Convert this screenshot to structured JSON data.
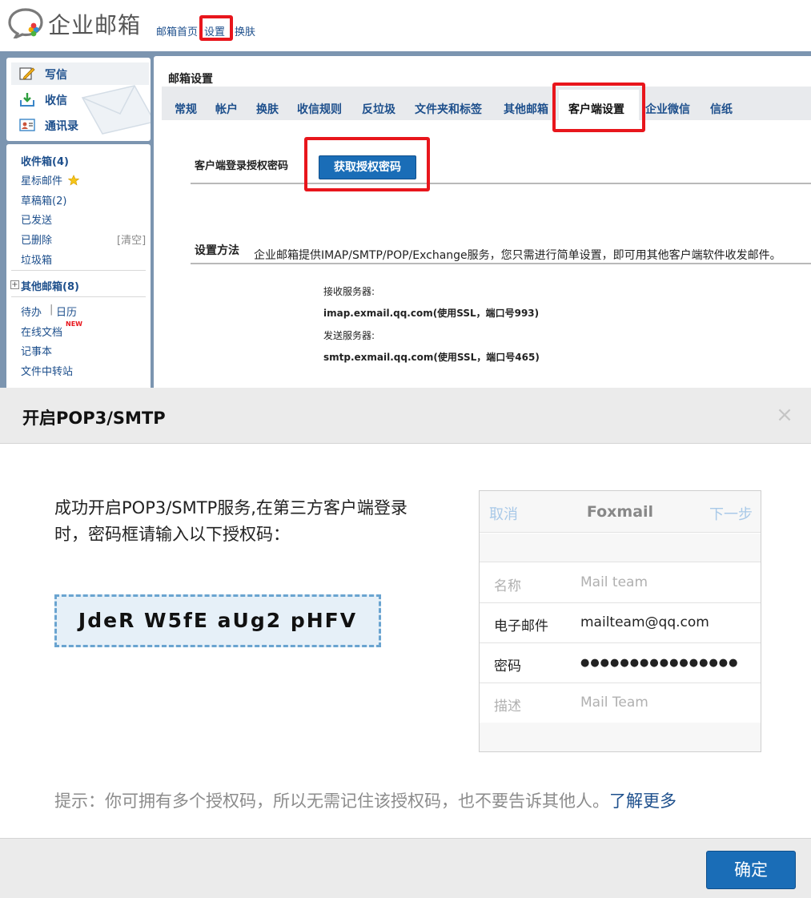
{
  "header": {
    "logo_text": "企业邮箱",
    "links": [
      "邮箱首页",
      "设置",
      "换肤"
    ]
  },
  "sidebar": {
    "compose": [
      {
        "label": "写信",
        "icon": "compose-icon"
      },
      {
        "label": "收信",
        "icon": "inbox-download-icon"
      },
      {
        "label": "通讯录",
        "icon": "contacts-icon"
      }
    ],
    "folders": [
      {
        "label": "收件箱(4)",
        "bold": true
      },
      {
        "label": "星标邮件",
        "icon": "star-icon"
      },
      {
        "label": "草稿箱(2)"
      },
      {
        "label": "已发送"
      },
      {
        "label": "已删除",
        "action": "[清空]"
      },
      {
        "label": "垃圾箱"
      }
    ],
    "other_mailboxes": "其他邮箱(8)",
    "tools": [
      {
        "label": "待办"
      },
      {
        "label": "日历"
      },
      {
        "label": "在线文档",
        "badge": "NEW"
      },
      {
        "label": "记事本"
      },
      {
        "label": "文件中转站"
      }
    ]
  },
  "settings": {
    "title": "邮箱设置",
    "tabs": [
      "常规",
      "帐户",
      "换肤",
      "收信规则",
      "反垃圾",
      "文件夹和标签",
      "其他邮箱",
      "客户端设置",
      "企业微信",
      "信纸"
    ],
    "active_tab": "客户端设置",
    "auth_label": "客户端登录授权密码",
    "auth_button": "获取授权密码",
    "method_label": "设置方法",
    "method_desc": "企业邮箱提供IMAP/SMTP/POP/Exchange服务，您只需进行简单设置，即可用其他客户端软件收发邮件。",
    "recv_label": "接收服务器:",
    "recv_value": "imap.exmail.qq.com(使用SSL，端口号993)",
    "send_label": "发送服务器:",
    "send_value": "smtp.exmail.qq.com(使用SSL，端口号465)"
  },
  "modal": {
    "title": "开启POP3/SMTP",
    "close": "×",
    "message": "成功开启POP3/SMTP服务,在第三方客户端登录时，密码框请输入以下授权码：",
    "code": "JdeR W5fE aUg2 pHFV",
    "tip": "提示：你可拥有多个授权码，所以无需记住该授权码，也不要告诉其他人。",
    "tip_link": "了解更多",
    "ok": "确定"
  },
  "phone": {
    "cancel": "取消",
    "title": "Foxmail",
    "next": "下一步",
    "rows": [
      {
        "k": "名称",
        "v": "Mail team",
        "dim": true
      },
      {
        "k": "电子邮件",
        "v": "mailteam@qq.com",
        "dim": false
      },
      {
        "k": "密码",
        "v": "●●●●●●●●●●●●●●●●",
        "dim": false
      },
      {
        "k": "描述",
        "v": "Mail Team",
        "dim": true
      }
    ]
  },
  "colors": {
    "accent": "#1a6db7",
    "link": "#1d4f8c",
    "highlight_box": "#e8161c",
    "sidebar_bg": "#7c95b0",
    "code_bg": "#e6f0f8",
    "code_border": "#6aa4d0"
  }
}
